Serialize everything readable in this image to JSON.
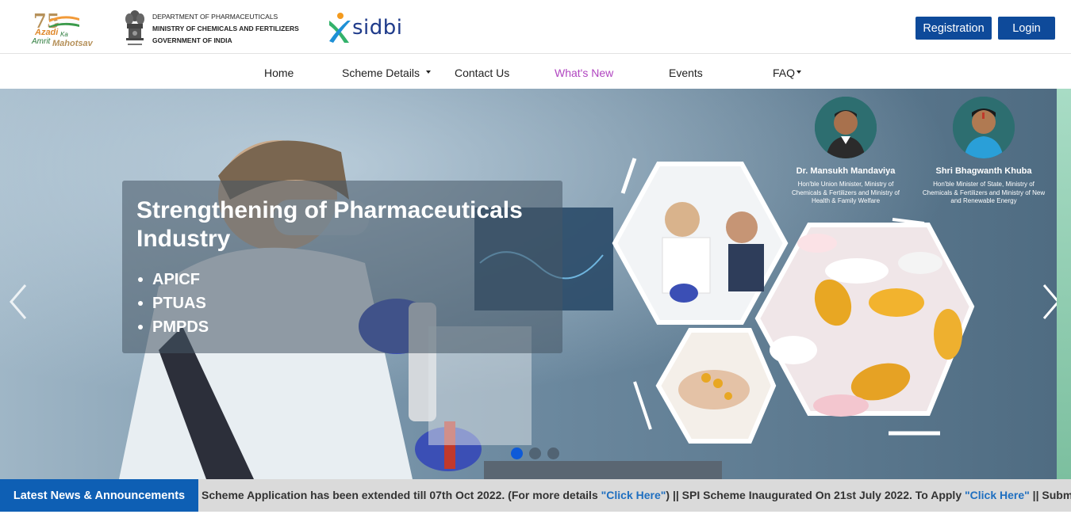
{
  "header": {
    "azadi_logo": {
      "number": "75",
      "line1": "Azadi",
      "line2": "Ka",
      "line3": "Amrit",
      "line4": "Mahotsav"
    },
    "department": {
      "line1": "DEPARTMENT OF PHARMACEUTICALS",
      "line2": "MINISTRY OF CHEMICALS AND FERTILIZERS",
      "line3": "GOVERNMENT OF INDIA"
    },
    "partner_logo": "sidbi",
    "registration_label": "Registration",
    "login_label": "Login"
  },
  "nav": {
    "home": "Home",
    "scheme_details": "Scheme Details",
    "contact_us": "Contact Us",
    "whats_new": "What's New",
    "events": "Events",
    "faq": "FAQ"
  },
  "hero": {
    "title": "Strengthening of Pharmaceuticals Industry",
    "bullets": [
      "APICF",
      "PTUAS",
      "PMPDS"
    ],
    "slide_count": 3,
    "active_slide": 1,
    "ministers": [
      {
        "name": "Dr. Mansukh Mandaviya",
        "role": "Hon'ble Union Minister, Ministry of Chemicals & Fertilizers and Ministry of Health & Family Welfare"
      },
      {
        "name": "Shri Bhagwanth Khuba",
        "role": "Hon'ble Minister of State, Ministry of Chemicals & Fertilizers and Ministry of New and Renewable Energy"
      }
    ]
  },
  "ticker": {
    "label": "Latest News & Announcements",
    "part1": "Scheme Application has been extended till 07th Oct 2022. (For more details ",
    "link1": "\"Click Here\"",
    "part2": ") || SPI Scheme Inaugurated On 21st July 2022. To Apply ",
    "link2": "\"Click Here\"",
    "part3": " || Submission of AP"
  },
  "colors": {
    "primary_button": "#0e4a9a",
    "active_nav": "#b045c0",
    "ticker_label_bg": "#0e5fb4",
    "ticker_bg": "#dadada",
    "link": "#1f6fc0"
  }
}
